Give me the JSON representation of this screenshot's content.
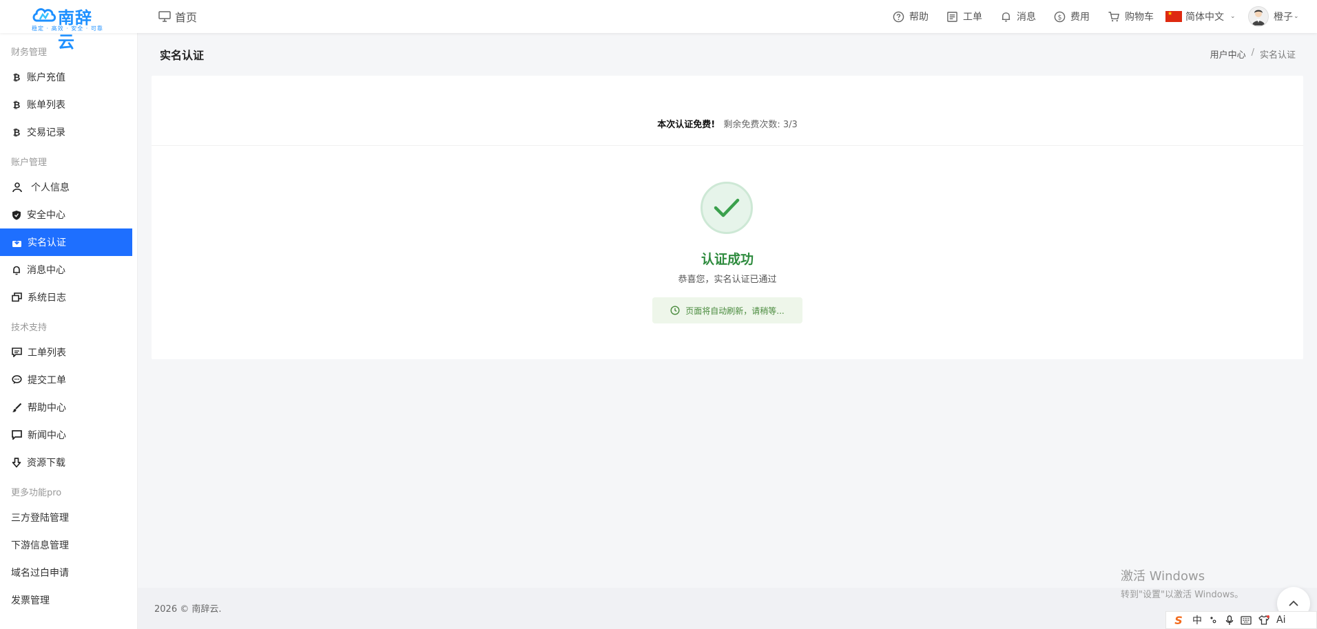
{
  "brand": {
    "name": "南辞云",
    "slogan": "稳定 · 高效 · 安全 · 可靠",
    "color": "#1e90ff"
  },
  "topnav": {
    "home": "首页",
    "help": "帮助",
    "ticket": "工单",
    "message": "消息",
    "fee": "费用",
    "cart": "购物车",
    "language": "简体中文",
    "user": "橙子"
  },
  "sidebar": {
    "groups": [
      {
        "title": "财务管理",
        "items": [
          "账户充值",
          "账单列表",
          "交易记录"
        ]
      },
      {
        "title": "账户管理",
        "items": [
          "个人信息",
          "安全中心",
          "实名认证",
          "消息中心",
          "系统日志"
        ]
      },
      {
        "title": "技术支持",
        "items": [
          "工单列表",
          "提交工单",
          "帮助中心",
          "新闻中心",
          "资源下载"
        ]
      },
      {
        "title": "更多功能pro",
        "items": [
          "三方登陆管理",
          "下游信息管理",
          "域名过白申请",
          "发票管理"
        ]
      }
    ],
    "active": "实名认证",
    "active_color": "#1e6fff"
  },
  "page": {
    "title": "实名认证",
    "breadcrumb": [
      "用户中心",
      "/",
      "实名认证"
    ]
  },
  "card": {
    "free_bold": "本次认证免费!",
    "free_remaining": "剩余免费次数:  3/3",
    "success_title": "认证成功",
    "success_sub": "恭喜您，实名认证已通过",
    "refresh_notice": "页面将自动刷新，请稍等...",
    "success_color": "#2e8b3e"
  },
  "footer": {
    "copyright": "2026 © 南辞云."
  },
  "watermark": {
    "line1": "激活 Windows",
    "line2": "转到\"设置\"以激活 Windows。"
  },
  "ime": {
    "mode": "中",
    "ai": "Ai"
  }
}
